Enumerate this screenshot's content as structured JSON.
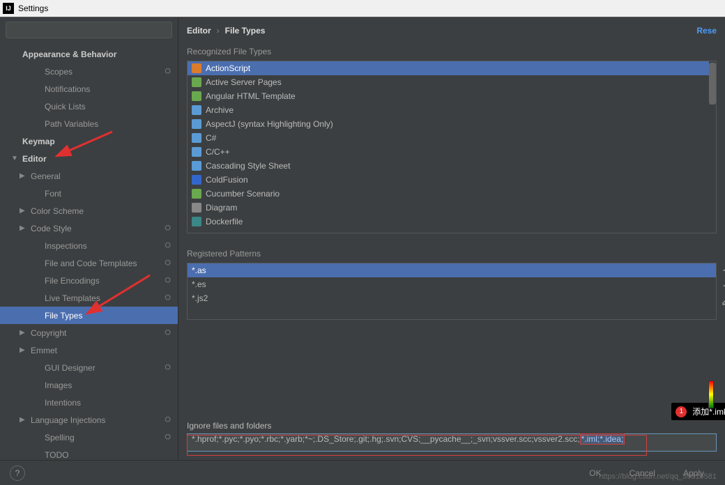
{
  "title": "Settings",
  "breadcrumb": {
    "root": "Editor",
    "leaf": "File Types",
    "reset": "Rese"
  },
  "sidebar": {
    "items": [
      {
        "label": "Appearance & Behavior",
        "bold": true,
        "depth": 0,
        "arrow": "",
        "gear": false
      },
      {
        "label": "Scopes",
        "depth": 2,
        "gear": true
      },
      {
        "label": "Notifications",
        "depth": 2
      },
      {
        "label": "Quick Lists",
        "depth": 2
      },
      {
        "label": "Path Variables",
        "depth": 2
      },
      {
        "label": "Keymap",
        "bold": true,
        "depth": 0
      },
      {
        "label": "Editor",
        "bold": true,
        "depth": 0,
        "arrow": "▼"
      },
      {
        "label": "General",
        "depth": 1,
        "arrow": "▶"
      },
      {
        "label": "Font",
        "depth": 2
      },
      {
        "label": "Color Scheme",
        "depth": 1,
        "arrow": "▶"
      },
      {
        "label": "Code Style",
        "depth": 1,
        "arrow": "▶",
        "gear": true
      },
      {
        "label": "Inspections",
        "depth": 2,
        "gear": true
      },
      {
        "label": "File and Code Templates",
        "depth": 2,
        "gear": true
      },
      {
        "label": "File Encodings",
        "depth": 2,
        "gear": true
      },
      {
        "label": "Live Templates",
        "depth": 2,
        "gear": true
      },
      {
        "label": "File Types",
        "depth": 2,
        "selected": true
      },
      {
        "label": "Copyright",
        "depth": 1,
        "arrow": "▶",
        "gear": true
      },
      {
        "label": "Emmet",
        "depth": 1,
        "arrow": "▶"
      },
      {
        "label": "GUI Designer",
        "depth": 2,
        "gear": true
      },
      {
        "label": "Images",
        "depth": 2
      },
      {
        "label": "Intentions",
        "depth": 2
      },
      {
        "label": "Language Injections",
        "depth": 1,
        "arrow": "▶",
        "gear": true
      },
      {
        "label": "Spelling",
        "depth": 2,
        "gear": true
      },
      {
        "label": "TODO",
        "depth": 2
      }
    ]
  },
  "sections": {
    "recognized": "Recognized File Types",
    "patterns": "Registered Patterns",
    "ignore": "Ignore files and folders"
  },
  "file_types": [
    {
      "label": "ActionScript",
      "color": "#db7b2b",
      "selected": true
    },
    {
      "label": "Active Server Pages",
      "color": "#6aa84f"
    },
    {
      "label": "Angular HTML Template",
      "color": "#6aa84f"
    },
    {
      "label": "Archive",
      "color": "#5b9bd5"
    },
    {
      "label": "AspectJ (syntax Highlighting Only)",
      "color": "#5b9bd5"
    },
    {
      "label": "C#",
      "color": "#5b9bd5"
    },
    {
      "label": "C/C++",
      "color": "#5b9bd5"
    },
    {
      "label": "Cascading Style Sheet",
      "color": "#5b9bd5"
    },
    {
      "label": "ColdFusion",
      "color": "#3366cc"
    },
    {
      "label": "Cucumber Scenario",
      "color": "#6aa84f"
    },
    {
      "label": "Diagram",
      "color": "#888888"
    },
    {
      "label": "Dockerfile",
      "color": "#3b8686"
    }
  ],
  "patterns": [
    {
      "label": "*.as",
      "selected": true
    },
    {
      "label": "*.es"
    },
    {
      "label": "*.js2"
    }
  ],
  "ignore_value_pre": "*.hprof;*.pyc;*.pyo;*.rbc;*.yarb;*~;.DS_Store;.git;.hg;.svn;CVS;__pycache__;_svn;vssver.scc;vssver2.scc;",
  "ignore_value_sel": "*.iml;*.idea;",
  "annotation": {
    "num": "1",
    "text": "添加*.iml;*.idea;"
  },
  "footer": {
    "ok": "OK",
    "cancel": "Cancel",
    "apply": "Apply"
  },
  "watermark": "https://blog.csdn.net/qq_39816581"
}
